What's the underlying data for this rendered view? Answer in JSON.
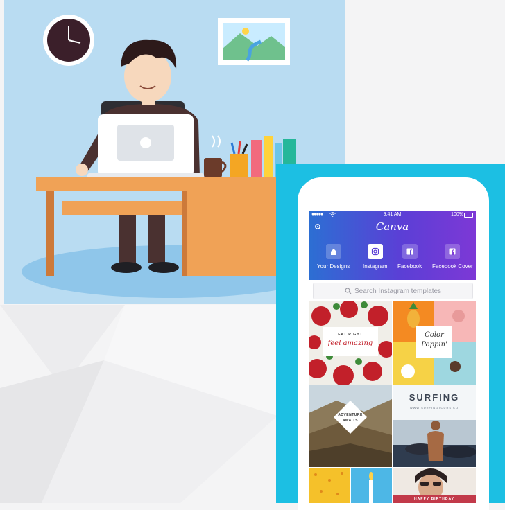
{
  "colors": {
    "illustration_bg": "#b9dcf2",
    "frame": "#1cbfe3",
    "header_gradient_start": "#2c6fd3",
    "header_gradient_end": "#7d38d6"
  },
  "phone": {
    "status": {
      "signal": "●●●●●",
      "time": "9:41 AM",
      "battery": "100%"
    },
    "app_name": "Canva",
    "categories": [
      {
        "label": "Your Designs",
        "icon": "home-icon",
        "selected": false
      },
      {
        "label": "Instagram",
        "icon": "instagram-icon",
        "selected": true
      },
      {
        "label": "Facebook",
        "icon": "facebook-icon",
        "selected": false
      },
      {
        "label": "Facebook Cover",
        "icon": "facebook-icon",
        "selected": false
      }
    ],
    "search": {
      "placeholder": "Search Instagram templates",
      "icon": "search-icon"
    },
    "templates": [
      {
        "name": "strawberries",
        "line1": "EAT RIGHT",
        "line2": "feel amazing"
      },
      {
        "name": "color-poppin",
        "line1": "Color",
        "line2": "Poppin'"
      },
      {
        "name": "adventure",
        "line1": "ADVENTURE",
        "line2": "AWAITS"
      },
      {
        "name": "surfing",
        "line1": "SURFING",
        "line2": "WWW.SURFINGTOURS.CO"
      },
      {
        "name": "birthday",
        "line1": "HAPPY BIRTHDAY",
        "line2": ""
      }
    ]
  }
}
